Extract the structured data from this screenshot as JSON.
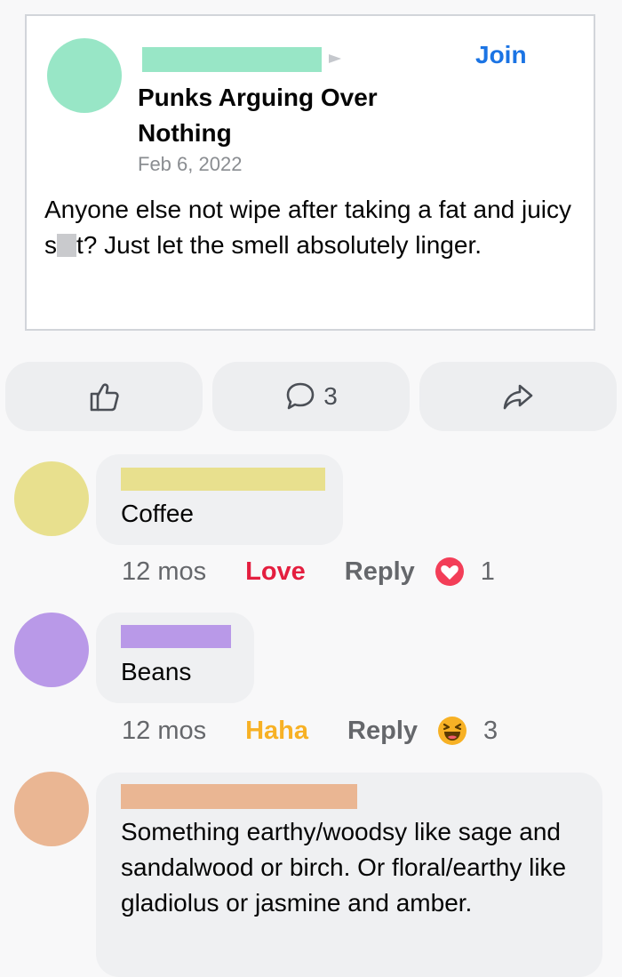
{
  "post": {
    "join_label": "Join",
    "group_name": "Punks Arguing Over Nothing",
    "date": "Feb 6, 2022",
    "text_before": "Anyone else not wipe after taking a fat and juicy s",
    "text_after": "t? Just let the smell absolutely linger."
  },
  "actions": {
    "comment_count": "3"
  },
  "comments": [
    {
      "text": "Coffee",
      "time": "12 mos",
      "reaction_label": "Love",
      "reply_label": "Reply",
      "reaction_count": "1",
      "reaction_icon": "heart-icon",
      "reaction_color": "#e41e3f"
    },
    {
      "text": "Beans",
      "time": "12 mos",
      "reaction_label": "Haha",
      "reply_label": "Reply",
      "reaction_count": "3",
      "reaction_icon": "haha-emoji-icon",
      "reaction_color": "#f7b125"
    },
    {
      "text": "Something earthy/woodsy like sage and sandalwood or birch. Or floral/earthy like gladiolus or jasmine and amber."
    }
  ],
  "colors": {
    "accent": "#1b74e4",
    "avatar_post": "#98e6c6",
    "avatar_1": "#e8e08e",
    "avatar_2": "#b999e8",
    "avatar_3": "#eab693"
  }
}
